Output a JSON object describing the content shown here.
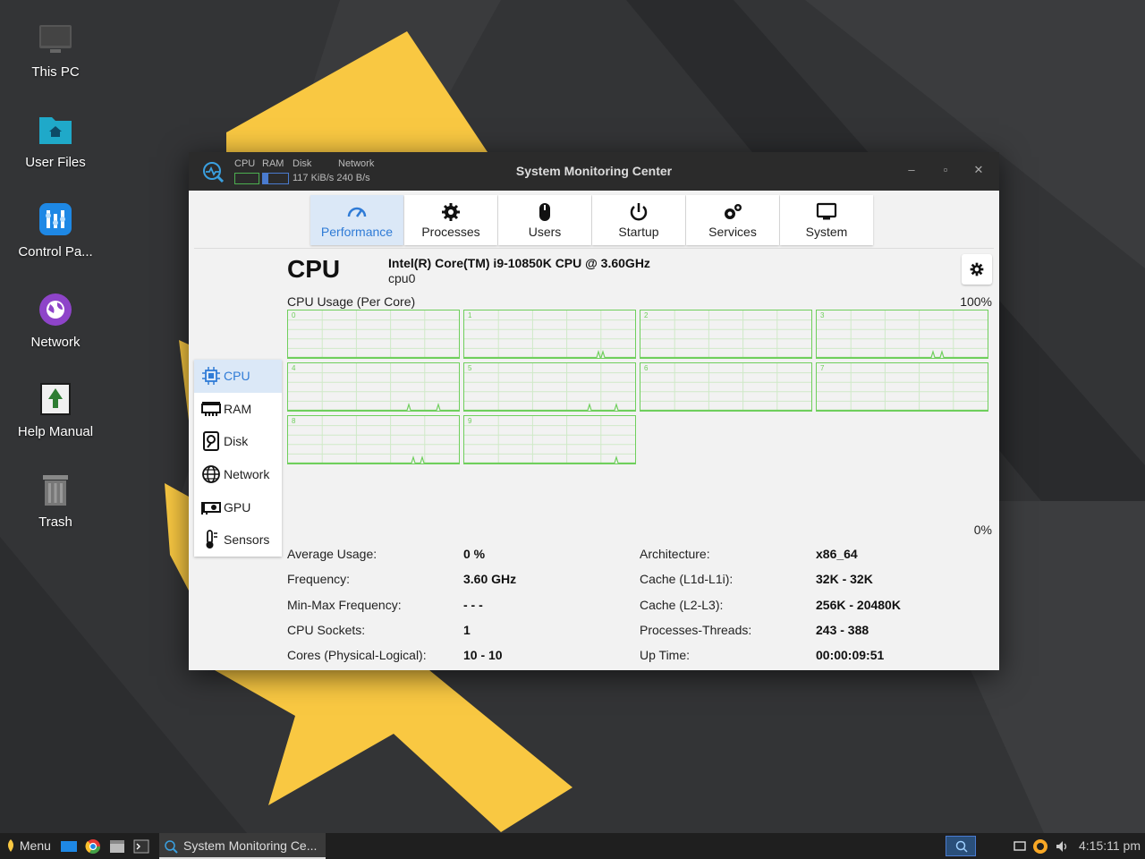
{
  "desktop": {
    "icons": [
      {
        "label": "This PC",
        "icon": "monitor-icon"
      },
      {
        "label": "User Files",
        "icon": "folder-home-icon"
      },
      {
        "label": "Control Pa...",
        "icon": "control-panel-icon"
      },
      {
        "label": "Network",
        "icon": "network-globe-icon"
      },
      {
        "label": "Help Manual",
        "icon": "help-manual-icon"
      },
      {
        "label": "Trash",
        "icon": "trash-icon"
      }
    ]
  },
  "window": {
    "title": "System Monitoring Center",
    "mini_labels": {
      "cpu": "CPU",
      "ram": "RAM",
      "disk": "Disk",
      "network": "Network"
    },
    "network_speed": "117 KiB/s 240 B/s",
    "controls": {
      "minimize": "–",
      "maximize": "▫",
      "close": "✕"
    }
  },
  "tabs": [
    {
      "label": "Performance",
      "icon": "gauge-icon",
      "active": true
    },
    {
      "label": "Processes",
      "icon": "gear-icon"
    },
    {
      "label": "Users",
      "icon": "mouse-icon"
    },
    {
      "label": "Startup",
      "icon": "power-icon"
    },
    {
      "label": "Services",
      "icon": "gears-icon"
    },
    {
      "label": "System",
      "icon": "monitor-icon"
    }
  ],
  "sidebar": {
    "items": [
      {
        "label": "CPU",
        "icon": "cpu-chip-icon",
        "active": true
      },
      {
        "label": "RAM",
        "icon": "ram-icon"
      },
      {
        "label": "Disk",
        "icon": "disk-icon"
      },
      {
        "label": "Network",
        "icon": "globe-icon"
      },
      {
        "label": "GPU",
        "icon": "gpu-icon"
      },
      {
        "label": "Sensors",
        "icon": "thermometer-icon"
      }
    ]
  },
  "cpu": {
    "heading": "CPU",
    "model": "Intel(R) Core(TM) i9-10850K CPU @ 3.60GHz",
    "device": "cpu0",
    "usage_label": "CPU Usage (Per Core)",
    "max_pct": "100%",
    "min_pct": "0%",
    "cores": [
      "0",
      "1",
      "2",
      "3",
      "4",
      "5",
      "6",
      "7",
      "8",
      "9"
    ],
    "graph_color": "#6fcf5c"
  },
  "stats_left": [
    {
      "label": "Average Usage:",
      "value": "0 %"
    },
    {
      "label": "Frequency:",
      "value": "3.60 GHz"
    },
    {
      "label": "Min-Max Frequency:",
      "value": "- - -"
    },
    {
      "label": "CPU Sockets:",
      "value": "1"
    },
    {
      "label": "Cores (Physical-Logical):",
      "value": "10 - 10"
    }
  ],
  "stats_right": [
    {
      "label": "Architecture:",
      "value": "x86_64"
    },
    {
      "label": "Cache (L1d-L1i):",
      "value": "32K - 32K"
    },
    {
      "label": "Cache (L2-L3):",
      "value": "256K - 20480K"
    },
    {
      "label": "Processes-Threads:",
      "value": "243 - 388"
    },
    {
      "label": "Up Time:",
      "value": "00:00:09:51"
    }
  ],
  "taskbar": {
    "menu_label": "Menu",
    "task_label": "System Monitoring Ce...",
    "clock": "4:15:11 pm"
  },
  "colors": {
    "accent": "#2f7bd6",
    "active_bg": "#dbe8f7",
    "desktop_yellow": "#f9c842"
  }
}
